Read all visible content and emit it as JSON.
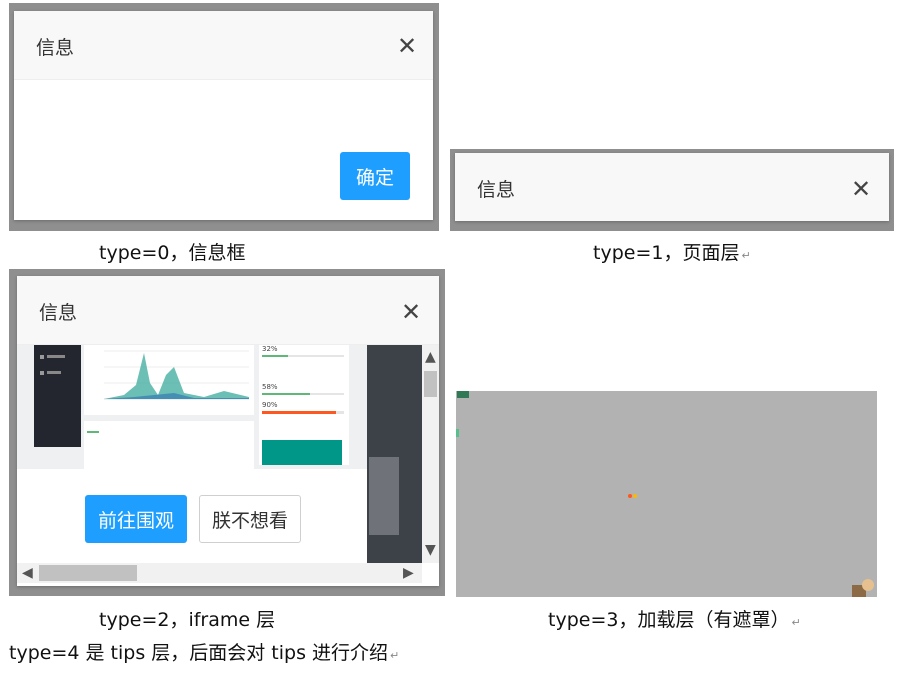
{
  "type0": {
    "title": "信息",
    "ok_label": "确定",
    "caption": "type=0，信息框"
  },
  "type1": {
    "title": "信息",
    "caption": "type=1，页面层"
  },
  "type2": {
    "title": "信息",
    "preview": {
      "metric1": "32%",
      "metric2": "58%",
      "metric3": "90%"
    },
    "go_label": "前往围观",
    "skip_label": "朕不想看",
    "caption": "type=2，iframe 层"
  },
  "type3": {
    "caption": "type=3，加载层（有遮罩）"
  },
  "footer": {
    "note": "type=4 是 tips 层，后面会对 tips 进行介绍"
  },
  "colors": {
    "primary": "#1e9fff",
    "frame_gray": "#8f8f8f",
    "mask_gray": "#b2b2b2",
    "chart_teal": "#3aa99b"
  }
}
